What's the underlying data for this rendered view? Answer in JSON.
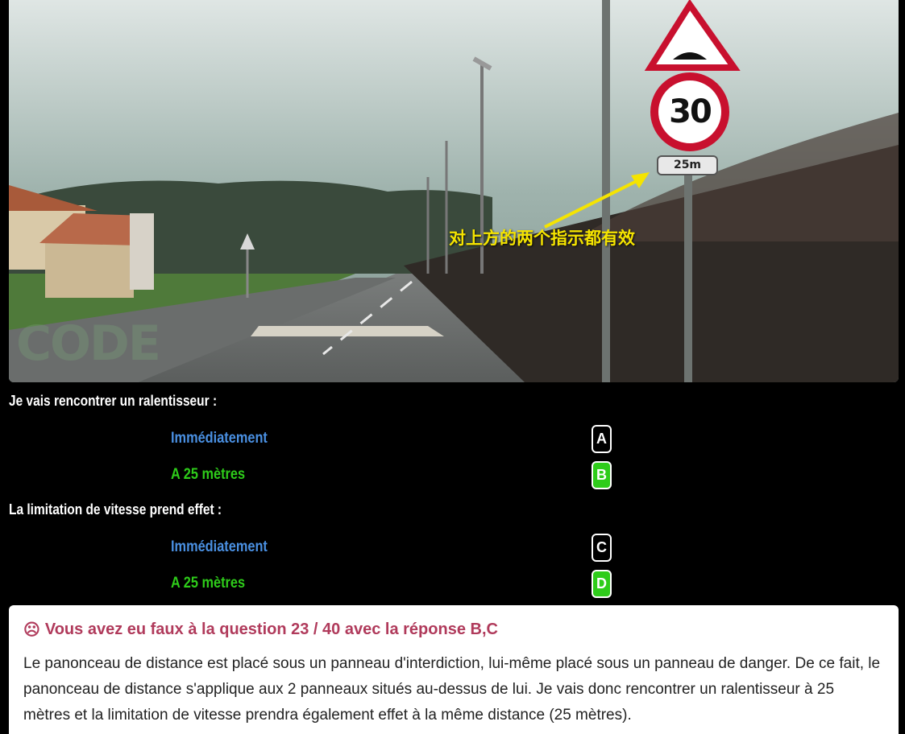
{
  "image": {
    "overlay_note": "对上方的两个指示都有效",
    "speed_limit": "30",
    "distance_plate": "25m",
    "watermark": "CODE"
  },
  "questions": [
    {
      "text": "Je vais rencontrer un ralentisseur :",
      "answers": [
        {
          "label": "Immédiatement",
          "letter": "A",
          "correct": false
        },
        {
          "label": "A 25 mètres",
          "letter": "B",
          "correct": true
        }
      ]
    },
    {
      "text": "La limitation de vitesse prend effet :",
      "answers": [
        {
          "label": "Immédiatement",
          "letter": "C",
          "correct": false
        },
        {
          "label": "A 25 mètres",
          "letter": "D",
          "correct": true
        }
      ]
    }
  ],
  "feedback": {
    "icon": "frown-icon",
    "icon_glyph": "☹",
    "title": "Vous avez eu faux à la question 23 / 40 avec la réponse B,C",
    "body": "Le panonceau de distance est placé sous un panneau d'interdiction, lui-même placé sous un panneau de danger. De ce fait, le panonceau de distance s'applique aux 2 panneaux situés au-dessus de lui. Je vais donc rencontrer un ralentisseur à 25 mètres et la limitation de vitesse prendra également effet à la même distance (25 mètres)."
  },
  "colors": {
    "correct": "#2ecc1a",
    "neutral": "#4a90e2",
    "error_title": "#b03a5b",
    "note_yellow": "#f5e400"
  }
}
